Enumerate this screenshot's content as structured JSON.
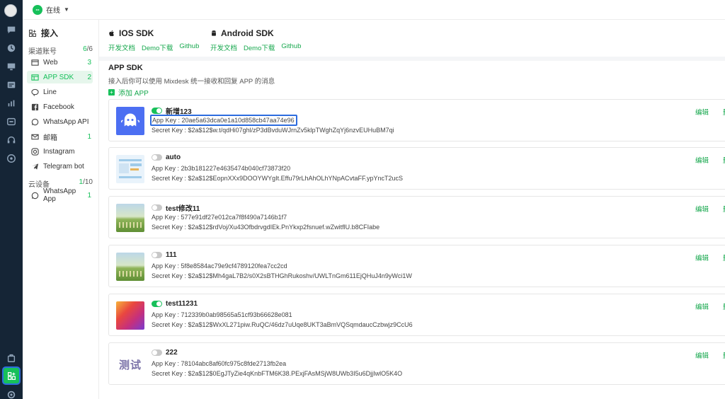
{
  "topbar": {
    "status_label": "在线"
  },
  "sidebar": {
    "heading": "接入",
    "channel_group": {
      "label": "渠道账号",
      "count_active": "6",
      "count_total": "/6"
    },
    "channels": [
      {
        "label": "Web",
        "count": "3"
      },
      {
        "label": "APP SDK",
        "count": "2"
      },
      {
        "label": "Line",
        "count": ""
      },
      {
        "label": "Facebook",
        "count": ""
      },
      {
        "label": "WhatsApp API",
        "count": ""
      },
      {
        "label": "邮箱",
        "count": "1"
      },
      {
        "label": "Instagram",
        "count": ""
      },
      {
        "label": "Telegram bot",
        "count": ""
      }
    ],
    "cloud_group": {
      "label": "云设备",
      "count_active": "1",
      "count_total": "/10"
    },
    "cloud_items": [
      {
        "label": "WhatsApp App",
        "count": "1"
      }
    ]
  },
  "sdks": {
    "ios": {
      "title": "IOS SDK",
      "docs": "开发文档",
      "demo": "Demo下载",
      "github": "Github"
    },
    "android": {
      "title": "Android SDK",
      "docs": "开发文档",
      "demo": "Demo下载",
      "github": "Github"
    }
  },
  "section": {
    "title": "APP SDK",
    "description": "接入后你可以使用 Mixdesk 统一接收和回复 APP 的消息",
    "add_label": "添加 APP"
  },
  "apps": [
    {
      "name": "新增123",
      "enabled": true,
      "app_key": "App Key : 20ae5a63dca0e1a10d858cb47aa74e96",
      "secret_key": "Secret Key : $2a$12$w.t/qdHi07ghl/zP3dBvduWJrnZv5klpTWghZqYj6nzvEUHuBM7qi",
      "edit": "编辑",
      "delete": "删除"
    },
    {
      "name": "auto",
      "enabled": false,
      "app_key": "App Key : 2b3b181227e4635474b040cf73873f20",
      "secret_key": "Secret Key : $2a$12$EopnXXx9DOOYWYgIt.Effu79rLhAhOLhYNpACvtaFF.ypYncT2ucS",
      "edit": "编辑",
      "delete": "删除"
    },
    {
      "name": "test修改11",
      "enabled": false,
      "app_key": "App Key : 577e91df27e012ca7f8f490a7146b1f7",
      "secret_key": "Secret Key : $2a$12$rdVoj/Xu43OfbdrvgdIEk.PnYkxp2fsnuef.wZwitflU.b8CFIabe",
      "edit": "编辑",
      "delete": "删除"
    },
    {
      "name": "111",
      "enabled": false,
      "app_key": "App Key : 5f8e8584ac79e9cf4789120fea7cc2cd",
      "secret_key": "Secret Key : $2a$12$Mh4gaL7B2/s0X2sBTHGhRukoshv/UWLTnGm611EjQHuJ4n9yWci1W",
      "edit": "编辑",
      "delete": "删除"
    },
    {
      "name": "test11231",
      "enabled": true,
      "app_key": "App Key : 712339b0ab98565a51cf93b66628e081",
      "secret_key": "Secret Key : $2a$12$WxXL271piw.RuQC/46dz7uUqe8UKT3aBmVQSqmdaucCzbwjz9CcU6",
      "edit": "编辑",
      "delete": "删除"
    },
    {
      "name": "222",
      "enabled": false,
      "app_key": "App Key : 78104abc8af60fc975c8fde2713fb2ea",
      "secret_key": "Secret Key : $2a$12$0EgJTyZie4qKnbFTM6K38.PExjFAsMSjW8UWb3I5u6DjjIwlO5K4O",
      "edit": "编辑",
      "delete": "删除"
    }
  ],
  "thumb_labels": {
    "test_logo": "测试"
  },
  "colors": {
    "brand_green": "#17c05a",
    "rail_bg": "#152536",
    "highlight_blue": "#2d6cdf"
  }
}
